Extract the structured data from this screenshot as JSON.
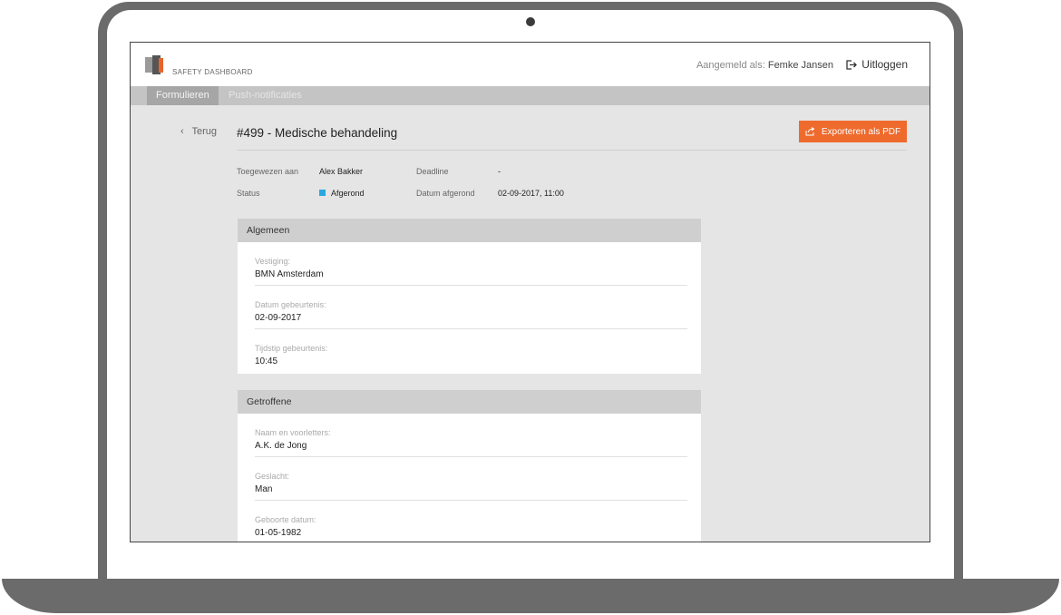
{
  "header": {
    "brand": "SAFETY DASHBOARD",
    "user_prefix": "Aangemeld als:",
    "user_name": "Femke Jansen",
    "logout": "Uitloggen"
  },
  "tabs": [
    "Formulieren",
    "Push-notificaties"
  ],
  "page": {
    "back": "Terug",
    "title": "#499 - Medische behandeling",
    "export": "Exporteren als PDF"
  },
  "meta": {
    "assigned_label": "Toegewezen aan",
    "assigned_value": "Alex Bakker",
    "deadline_label": "Deadline",
    "deadline_value": "-",
    "status_label": "Status",
    "status_value": "Afgerond",
    "done_label": "Datum afgerond",
    "done_value": "02-09-2017, 11:00"
  },
  "sections": [
    {
      "title": "Algemeen",
      "fields": [
        {
          "label": "Vestiging:",
          "value": "BMN Amsterdam"
        },
        {
          "label": "Datum gebeurtenis:",
          "value": "02-09-2017"
        },
        {
          "label": "Tijdstip gebeurtenis:",
          "value": "10:45"
        }
      ]
    },
    {
      "title": "Getroffene",
      "fields": [
        {
          "label": "Naam en voorletters:",
          "value": "A.K. de Jong"
        },
        {
          "label": "Geslacht:",
          "value": "Man"
        },
        {
          "label": "Geboorte datum:",
          "value": "01-05-1982"
        }
      ]
    }
  ],
  "colors": {
    "accent": "#ef6a2d",
    "status": "#2aa7e0"
  },
  "icons": {
    "export": "share-icon",
    "logout": "logout-icon",
    "back": "chevron-left-icon"
  }
}
